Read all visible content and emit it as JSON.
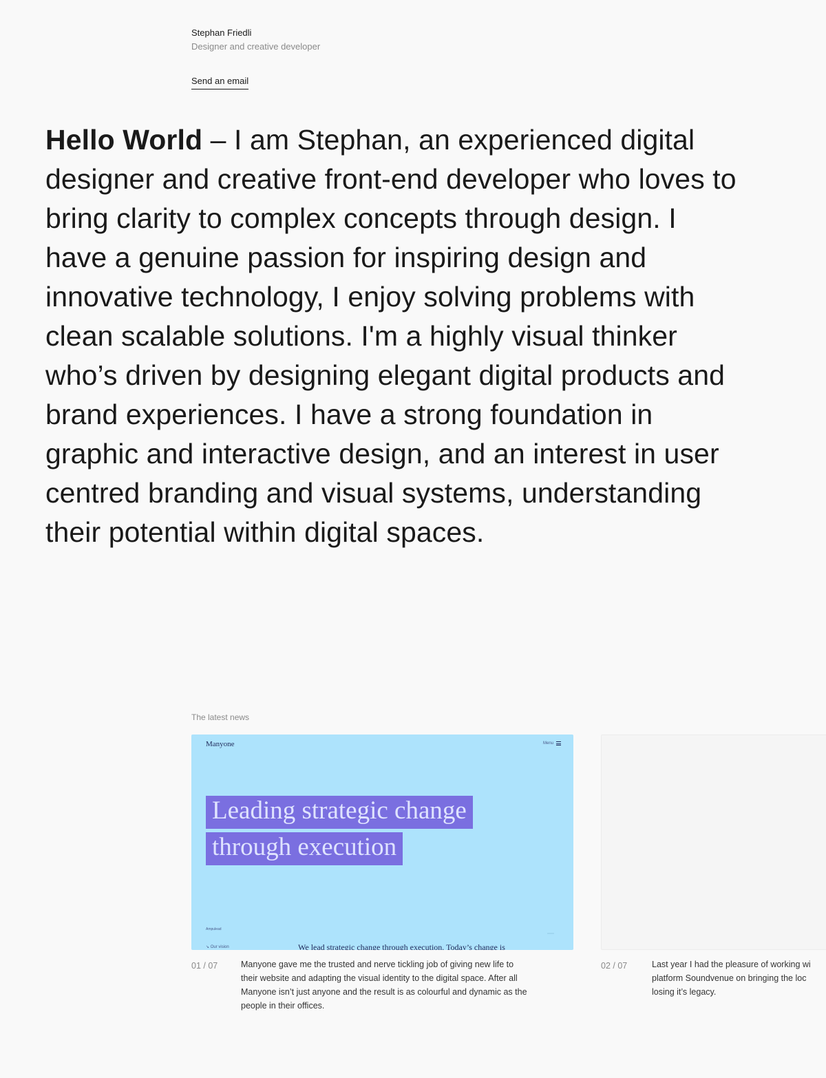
{
  "header": {
    "name": "Stephan Friedli",
    "role": "Designer and creative developer",
    "email_link": "Send an email"
  },
  "intro": {
    "bold": "Hello World",
    "text": " – I am Stephan, an experienced digital designer and creative front-end developer who loves to bring clarity to complex concepts through design. I have a genuine passion for inspiring design and innovative technology, I enjoy solving problems with clean scalable solutions. I'm a highly visual thinker who’s driven by designing elegant digital products and brand experiences. I have a strong foundation in graphic and interactive design, and an interest in user centred branding and visual systems, understanding their potential within digital spaces."
  },
  "news": {
    "label": "The latest news",
    "cards": [
      {
        "number": "01 / 07",
        "mock": {
          "logo": "Manyone",
          "menu": "Menu",
          "headline_line1": "Leading strategic change",
          "headline_line2": "through execution",
          "small_label": "Ampulead",
          "vision_label": "↘ Our vision",
          "body_text": "We lead strategic change through execution. Today’s change is"
        },
        "description_lines": [
          "Manyone gave me the trusted and nerve tickling job of giving new life to",
          "their website and adapting the visual identity to the digital space. After all",
          "Manyone isn’t just anyone and the result is as colourful and dynamic as the",
          "people in their offices."
        ]
      },
      {
        "number": "02 / 07",
        "description_lines": [
          "Last year I had the pleasure of working wi",
          "platform Soundvenue on bringing the loc",
          "losing it’s legacy."
        ]
      }
    ]
  },
  "colors": {
    "background": "#f9f9f9",
    "card_bg": "#ade3fc",
    "highlight": "#7a6fe0",
    "text": "#1a1a1a",
    "muted": "#8a8a8a"
  }
}
